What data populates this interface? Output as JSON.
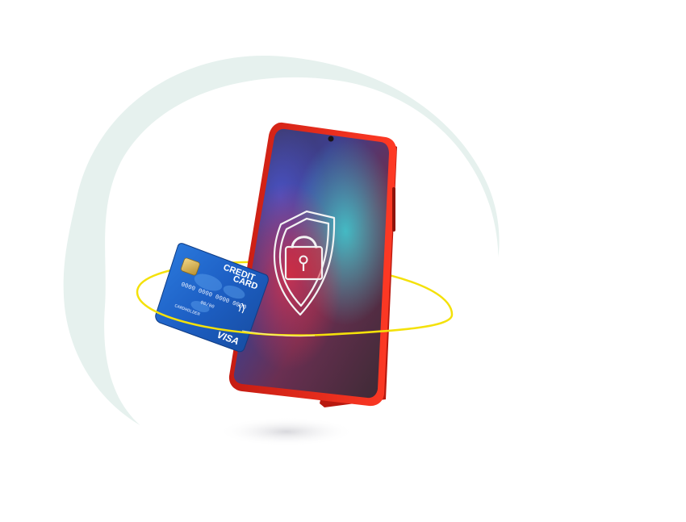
{
  "illustration": {
    "subject": "smartphone-with-lock-shield",
    "colors": {
      "phone_frame": "#e8261a",
      "ring": "#f4e10a",
      "blob_back": "#e6f1ee",
      "blob_front": "#ffffff",
      "card_blue": "#1d5fc4",
      "shield_outline": "#f3f3f3"
    }
  },
  "credit_card": {
    "title_line1": "CREDIT",
    "title_line2": "CARD",
    "number": "0000 0000 0000 0000",
    "valid": "00/00",
    "holder": "CARDHOLDER",
    "brand": "VISA"
  },
  "icons": {
    "lock": "padlock-icon",
    "shield": "shield-icon",
    "contactless": "contactless-icon"
  }
}
